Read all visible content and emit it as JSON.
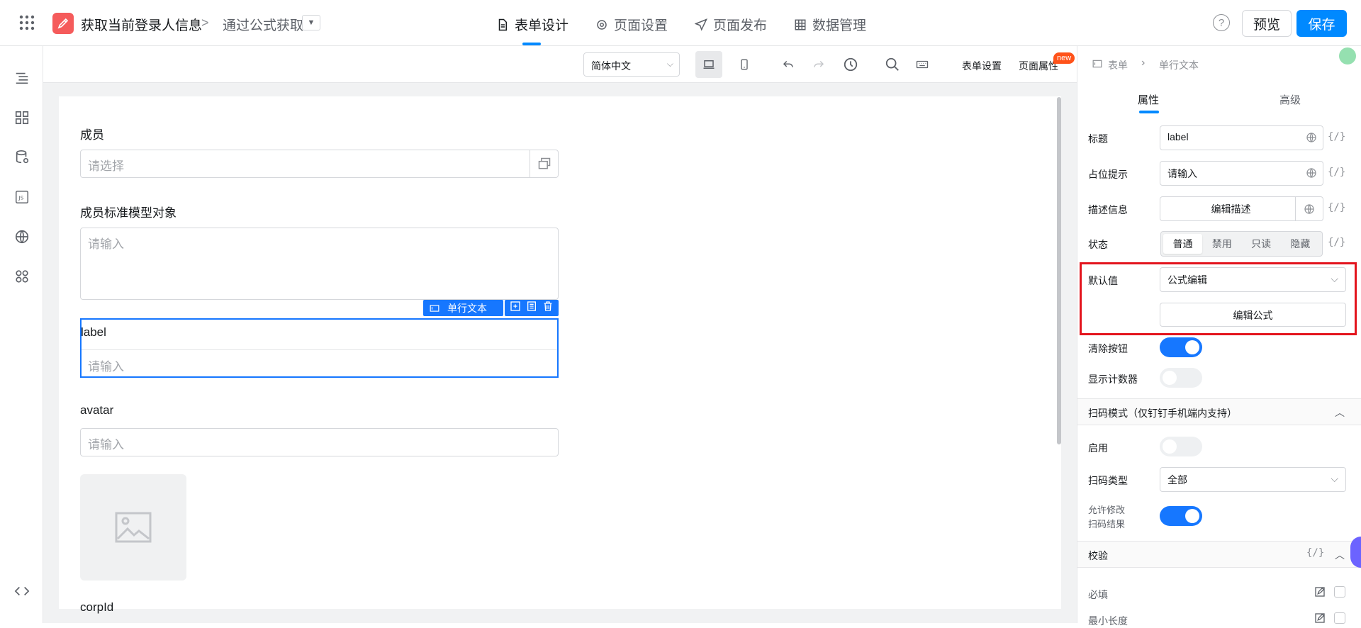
{
  "app": {
    "title": "获取当前登录人信息",
    "breadcrumb_sep": ">",
    "subtitle": "通过公式获取",
    "dropdown_icon": "caret-down-icon"
  },
  "header_tabs": [
    {
      "label": "表单设计",
      "icon": "document-icon",
      "active": true
    },
    {
      "label": "页面设置",
      "icon": "gear-icon",
      "active": false
    },
    {
      "label": "页面发布",
      "icon": "send-icon",
      "active": false
    },
    {
      "label": "数据管理",
      "icon": "table-icon",
      "active": false
    }
  ],
  "header_actions": {
    "help": "?",
    "preview": "预览",
    "save": "保存"
  },
  "toolbar": {
    "language": "简体中文",
    "form_settings": "表单设置",
    "page_properties": "页面属性",
    "new_badge": "new"
  },
  "form": {
    "fields": [
      {
        "label": "成员",
        "placeholder": "请选择",
        "type": "member-select"
      },
      {
        "label": "成员标准模型对象",
        "placeholder": "请输入",
        "type": "textarea"
      },
      {
        "label": "label",
        "placeholder": "请输入",
        "type": "text",
        "selected": true
      },
      {
        "label": "avatar",
        "placeholder": "请输入",
        "type": "text"
      },
      {
        "label": "corpId",
        "type": "text"
      }
    ],
    "selected_tag": "单行文本"
  },
  "panel": {
    "breadcrumb": [
      "表单",
      "单行文本"
    ],
    "tabs": [
      "属性",
      "高级"
    ],
    "active_tab": "属性",
    "props": {
      "title_label": "标题",
      "title_value": "label",
      "placeholder_label": "占位提示",
      "placeholder_value": "请输入",
      "desc_label": "描述信息",
      "desc_button": "编辑描述",
      "state_label": "状态",
      "state_options": [
        "普通",
        "禁用",
        "只读",
        "隐藏"
      ],
      "state_selected": "普通",
      "default_label": "默认值",
      "default_value": "公式编辑",
      "edit_formula": "编辑公式",
      "clear_label": "清除按钮",
      "clear_on": true,
      "counter_label": "显示计数器",
      "counter_on": false,
      "fx": "{/}"
    },
    "scan_section": {
      "title": "扫码模式（仅钉钉手机端内支持）",
      "enable_label": "启用",
      "enable_on": false,
      "type_label": "扫码类型",
      "type_value": "全部",
      "allow_modify_label_1": "允许修改",
      "allow_modify_label_2": "扫码结果",
      "allow_modify_on": true
    },
    "validation_section": {
      "title": "校验",
      "fx": "{/}",
      "required_label": "必填",
      "minlen_label": "最小长度"
    }
  },
  "colors": {
    "accent": "#0089ff",
    "highlight": "#e3141d",
    "brand": "#f55b5b"
  }
}
